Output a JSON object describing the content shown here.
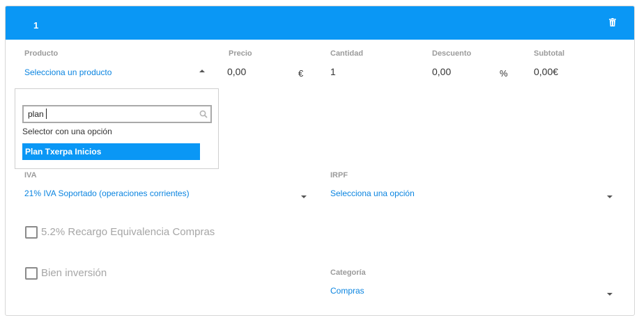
{
  "header": {
    "line_number": "1",
    "delete_icon": "trash-icon"
  },
  "product": {
    "label": "Producto",
    "value": "Selecciona un producto"
  },
  "price": {
    "label": "Precio",
    "value": "0,00",
    "unit": "€"
  },
  "quantity": {
    "label": "Cantidad",
    "value": "1"
  },
  "discount": {
    "label": "Descuento",
    "value": "0,00",
    "unit": "%"
  },
  "subtotal": {
    "label": "Subtotal",
    "value": "0,00€"
  },
  "product_dropdown": {
    "search_value": "plan",
    "hint": "Selector con una opción",
    "options": [
      {
        "label": "Plan Txerpa Inicios",
        "highlighted": true
      }
    ]
  },
  "iva": {
    "label": "IVA",
    "value": "21% IVA Soportado (operaciones corrientes)"
  },
  "irpf": {
    "label": "IRPF",
    "value": "Selecciona una opción"
  },
  "recargo": {
    "label": "5.2% Recargo Equivalencia Compras",
    "checked": false
  },
  "bien_inversion": {
    "label": "Bien inversión",
    "checked": false
  },
  "categoria": {
    "label": "Categoría",
    "value": "Compras"
  },
  "colors": {
    "accent": "#0a97f5",
    "link": "#0a84e0",
    "muted": "#9b9b9b"
  }
}
